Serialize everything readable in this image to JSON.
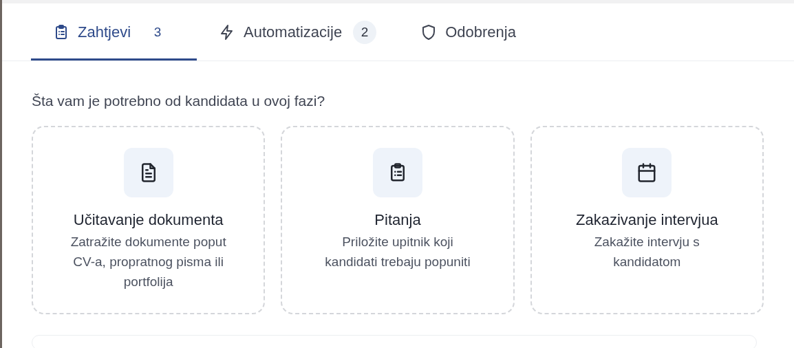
{
  "tabs": [
    {
      "kind": "clipboard",
      "label": "Zahtjevi",
      "count": "3",
      "selected": true
    },
    {
      "kind": "bolt",
      "label": "Automatizacije",
      "count": "2",
      "selected": false
    },
    {
      "kind": "shield",
      "label": "Odobrenja",
      "selected": false
    }
  ],
  "prompt": "Šta vam je potrebno od kandidata u ovoj fazi?",
  "options": [
    {
      "kind": "document",
      "title": "Učitavanje dokumenta",
      "description": "Zatražite dokumente poput CV-a, propratnog pisma ili portfolija"
    },
    {
      "kind": "clipboard",
      "title": "Pitanja",
      "description": "Priložite upitnik koji kandidati trebaju popuniti"
    },
    {
      "kind": "calendar",
      "title": "Zakazivanje intervjua",
      "description": "Zakažite intervju s kandidatom"
    }
  ]
}
